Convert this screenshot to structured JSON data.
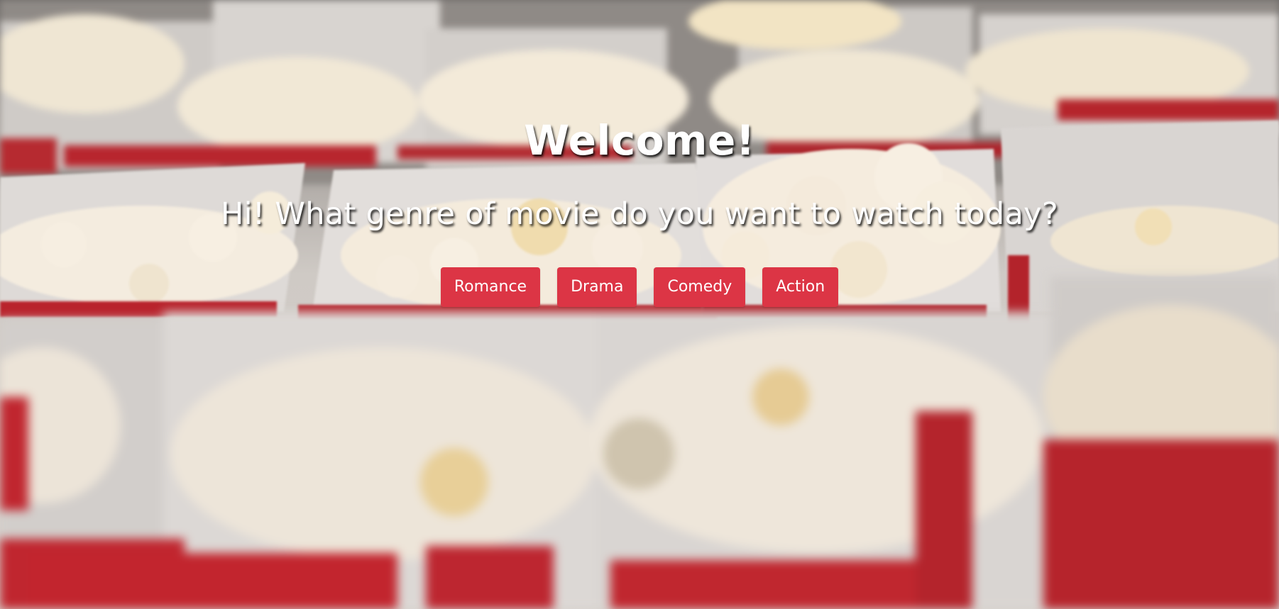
{
  "hero": {
    "title": "Welcome!",
    "subtitle": "Hi! What genre of movie do you want to watch today?"
  },
  "genres": {
    "romance": "Romance",
    "drama": "Drama",
    "comedy": "Comedy",
    "action": "Action"
  },
  "colors": {
    "button_background": "#dc3545",
    "button_text": "#ffffff",
    "heading_text": "#ffffff"
  },
  "background": {
    "image_subject": "popcorn-boxes"
  }
}
